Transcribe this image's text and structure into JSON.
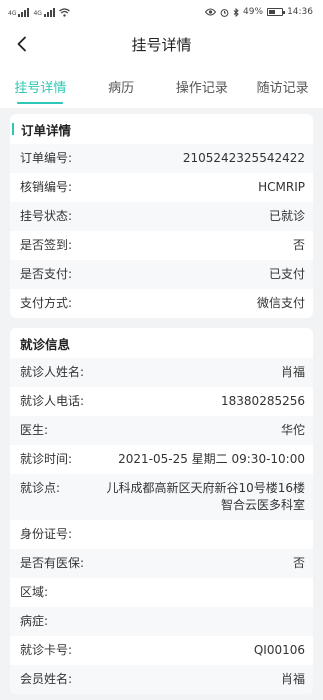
{
  "status_bar": {
    "signal_labels": [
      "4G",
      "4G"
    ],
    "battery": "49%",
    "battery_level": 0.49,
    "time": "14:36",
    "icons": [
      "signal-icon",
      "wifi-icon",
      "eye-icon",
      "alarm-icon",
      "bluetooth-icon",
      "battery-icon"
    ]
  },
  "header": {
    "title": "挂号详情",
    "back_icon": "chevron-left-icon"
  },
  "tabs": [
    {
      "label": "挂号详情",
      "active": true
    },
    {
      "label": "病历",
      "active": false
    },
    {
      "label": "操作记录",
      "active": false
    },
    {
      "label": "随访记录",
      "active": false
    }
  ],
  "order": {
    "title": "订单详情",
    "rows": [
      {
        "label": "订单编号:",
        "value": "2105242325542422"
      },
      {
        "label": "核销编号:",
        "value": "HCMRIP"
      },
      {
        "label": "挂号状态:",
        "value": "已就诊"
      },
      {
        "label": "是否签到:",
        "value": "否"
      },
      {
        "label": "是否支付:",
        "value": "已支付"
      },
      {
        "label": "支付方式:",
        "value": "微信支付"
      }
    ]
  },
  "visit": {
    "title": "就诊信息",
    "rows": [
      {
        "label": "就诊人姓名:",
        "value": "肖福"
      },
      {
        "label": "就诊人电话:",
        "value": "18380285256"
      },
      {
        "label": "医生:",
        "value": "华佗"
      },
      {
        "label": "就诊时间:",
        "value": "2021-05-25 星期二 09:30-10:00"
      },
      {
        "label": "就诊点:",
        "value": "儿科成都高新区天府新谷10号楼16楼智合云医多科室"
      },
      {
        "label": "身份证号:",
        "value": ""
      },
      {
        "label": "是否有医保:",
        "value": "否"
      },
      {
        "label": "区域:",
        "value": ""
      },
      {
        "label": "病症:",
        "value": ""
      },
      {
        "label": "就诊卡号:",
        "value": "QI00106"
      },
      {
        "label": "会员姓名:",
        "value": "肖福"
      }
    ]
  },
  "colors": {
    "accent": "#2ec7b6",
    "background": "#f2f3f5"
  }
}
